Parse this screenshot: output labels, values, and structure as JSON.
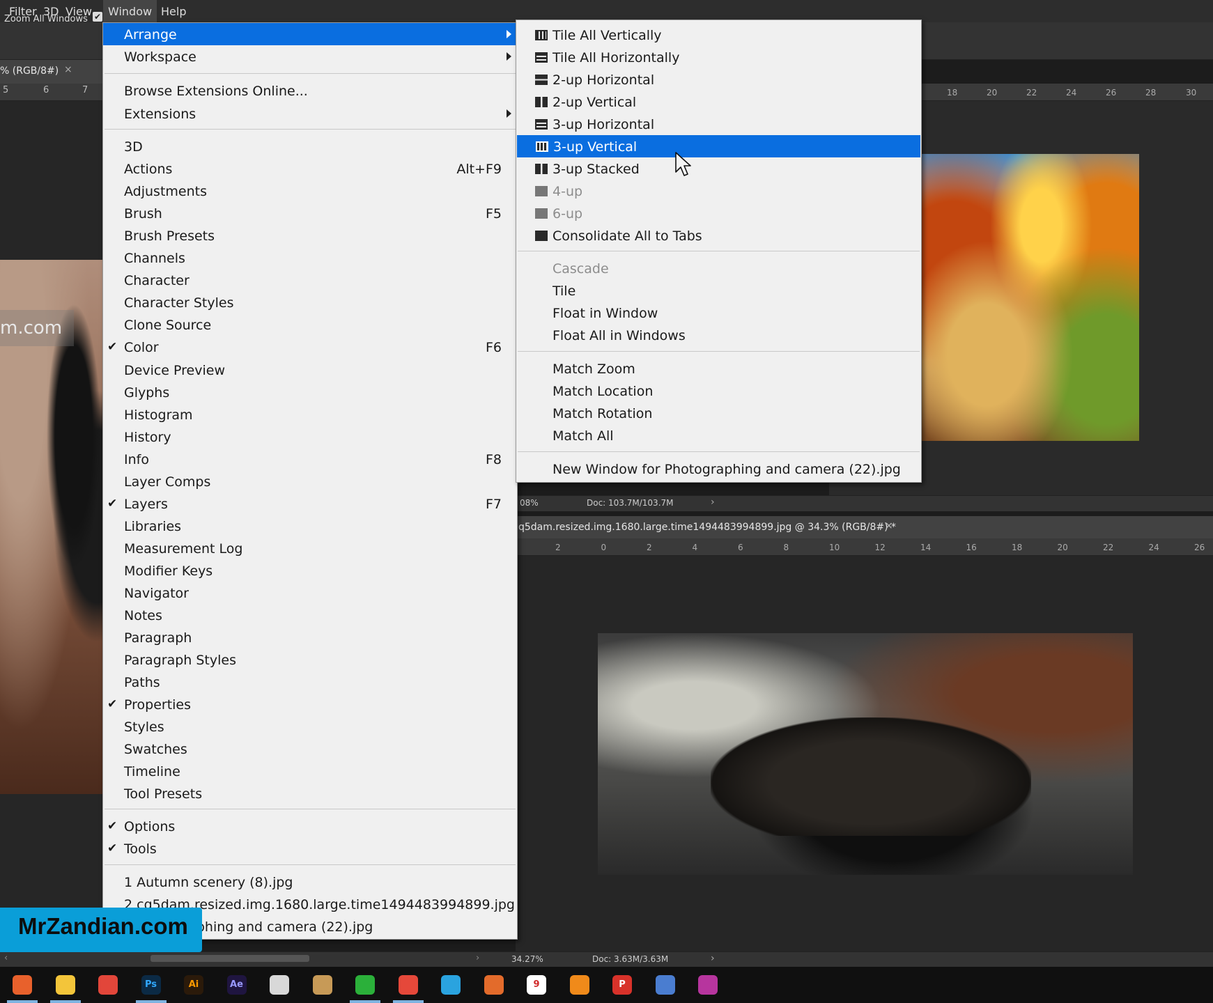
{
  "menubar": {
    "items": [
      "Filter",
      "3D",
      "View",
      "Window",
      "Help"
    ],
    "active_index": 3
  },
  "options_bar": {
    "zoom_all_windows_label": "Zoom All Windows",
    "zoom_all_windows_checked": true
  },
  "left_document": {
    "tab_label": "% (RGB/8#)",
    "ruler_ticks": [
      "5",
      "6",
      "7"
    ],
    "watermark_text": "m.com"
  },
  "top_right_document": {
    "ruler_ticks": [
      "18",
      "20",
      "22",
      "24",
      "26",
      "28",
      "30"
    ],
    "zoom": "08%",
    "doc_size": "Doc: 103.7M/103.7M"
  },
  "bottom_right_document": {
    "tab_label": "q5dam.resized.img.1680.large.time1494483994899.jpg @ 34.3% (RGB/8#) *",
    "ruler_ticks": [
      "2",
      "0",
      "2",
      "4",
      "6",
      "8",
      "10",
      "12",
      "14",
      "16",
      "18",
      "20",
      "22",
      "24",
      "26"
    ]
  },
  "bottom_status": {
    "zoom": "34.27%",
    "doc_size": "Doc: 3.63M/3.63M"
  },
  "window_menu": {
    "top_items": [
      {
        "label": "Arrange",
        "submenu": true,
        "highlighted": true
      },
      {
        "label": "Workspace",
        "submenu": true
      }
    ],
    "ext_items": [
      {
        "label": "Browse Extensions Online..."
      },
      {
        "label": "Extensions",
        "submenu": true
      }
    ],
    "panel_items": [
      {
        "label": "3D",
        "shortcut": "",
        "checked": false
      },
      {
        "label": "Actions",
        "shortcut": "Alt+F9",
        "checked": false
      },
      {
        "label": "Adjustments",
        "shortcut": "",
        "checked": false
      },
      {
        "label": "Brush",
        "shortcut": "F5",
        "checked": false
      },
      {
        "label": "Brush Presets",
        "shortcut": "",
        "checked": false
      },
      {
        "label": "Channels",
        "shortcut": "",
        "checked": false
      },
      {
        "label": "Character",
        "shortcut": "",
        "checked": false
      },
      {
        "label": "Character Styles",
        "shortcut": "",
        "checked": false
      },
      {
        "label": "Clone Source",
        "shortcut": "",
        "checked": false
      },
      {
        "label": "Color",
        "shortcut": "F6",
        "checked": true
      },
      {
        "label": "Device Preview",
        "shortcut": "",
        "checked": false
      },
      {
        "label": "Glyphs",
        "shortcut": "",
        "checked": false
      },
      {
        "label": "Histogram",
        "shortcut": "",
        "checked": false
      },
      {
        "label": "History",
        "shortcut": "",
        "checked": false
      },
      {
        "label": "Info",
        "shortcut": "F8",
        "checked": false
      },
      {
        "label": "Layer Comps",
        "shortcut": "",
        "checked": false
      },
      {
        "label": "Layers",
        "shortcut": "F7",
        "checked": true
      },
      {
        "label": "Libraries",
        "shortcut": "",
        "checked": false
      },
      {
        "label": "Measurement Log",
        "shortcut": "",
        "checked": false
      },
      {
        "label": "Modifier Keys",
        "shortcut": "",
        "checked": false
      },
      {
        "label": "Navigator",
        "shortcut": "",
        "checked": false
      },
      {
        "label": "Notes",
        "shortcut": "",
        "checked": false
      },
      {
        "label": "Paragraph",
        "shortcut": "",
        "checked": false
      },
      {
        "label": "Paragraph Styles",
        "shortcut": "",
        "checked": false
      },
      {
        "label": "Paths",
        "shortcut": "",
        "checked": false
      },
      {
        "label": "Properties",
        "shortcut": "",
        "checked": true
      },
      {
        "label": "Styles",
        "shortcut": "",
        "checked": false
      },
      {
        "label": "Swatches",
        "shortcut": "",
        "checked": false
      },
      {
        "label": "Timeline",
        "shortcut": "",
        "checked": false
      },
      {
        "label": "Tool Presets",
        "shortcut": "",
        "checked": false
      }
    ],
    "ui_items": [
      {
        "label": "Options",
        "checked": true
      },
      {
        "label": "Tools",
        "checked": true
      }
    ],
    "recent_files": [
      "1 Autumn scenery (8).jpg",
      "2 cq5dam.resized.img.1680.large.time1494483994899.jpg",
      "3 Photographing and camera (22).jpg"
    ]
  },
  "arrange_menu": {
    "layout_items": [
      {
        "label": "Tile All Vertically",
        "icon": "tile-vertical-icon",
        "disabled": false,
        "highlighted": false
      },
      {
        "label": "Tile All Horizontally",
        "icon": "tile-horizontal-icon",
        "disabled": false,
        "highlighted": false
      },
      {
        "label": "2-up Horizontal",
        "icon": "two-up-horizontal-icon",
        "disabled": false,
        "highlighted": false
      },
      {
        "label": "2-up Vertical",
        "icon": "two-up-vertical-icon",
        "disabled": false,
        "highlighted": false
      },
      {
        "label": "3-up Horizontal",
        "icon": "three-up-horizontal-icon",
        "disabled": false,
        "highlighted": false
      },
      {
        "label": "3-up Vertical",
        "icon": "three-up-vertical-icon",
        "disabled": false,
        "highlighted": true
      },
      {
        "label": "3-up Stacked",
        "icon": "three-up-stacked-icon",
        "disabled": false,
        "highlighted": false
      },
      {
        "label": "4-up",
        "icon": "four-up-icon",
        "disabled": true,
        "highlighted": false
      },
      {
        "label": "6-up",
        "icon": "six-up-icon",
        "disabled": true,
        "highlighted": false
      },
      {
        "label": "Consolidate All to Tabs",
        "icon": "consolidate-tabs-icon",
        "disabled": false,
        "highlighted": false
      }
    ],
    "window_items": [
      {
        "label": "Cascade",
        "disabled": true
      },
      {
        "label": "Tile",
        "disabled": false
      },
      {
        "label": "Float in Window",
        "disabled": false
      },
      {
        "label": "Float All in Windows",
        "disabled": false
      }
    ],
    "match_items": [
      {
        "label": "Match Zoom"
      },
      {
        "label": "Match Location"
      },
      {
        "label": "Match Rotation"
      },
      {
        "label": "Match All"
      }
    ],
    "new_window_item": "New Window for Photographing and camera (22).jpg"
  },
  "watermark_badge": "MrZandian.com",
  "taskbar": {
    "icons": [
      "firefox-icon",
      "file-explorer-icon",
      "app-red-icon",
      "photoshop-icon",
      "illustrator-icon",
      "after-effects-icon",
      "chrome-icon",
      "app-owl-icon",
      "camtasia-green-icon",
      "camtasia-red-icon",
      "telegram-icon",
      "feather-icon",
      "app-9-icon",
      "app-orange-icon",
      "powerpoint-icon",
      "network-icon",
      "app-purple-icon"
    ],
    "icon_texts": [
      "",
      "",
      "",
      "Ps",
      "Ai",
      "Ae",
      "",
      "",
      "",
      "",
      "",
      "",
      "9",
      "",
      "P",
      "",
      ""
    ]
  },
  "colors": {
    "menu_highlight": "#0a6ee0",
    "menu_bg": "#f0f0f0",
    "badge_bg": "#0a9ed8"
  }
}
